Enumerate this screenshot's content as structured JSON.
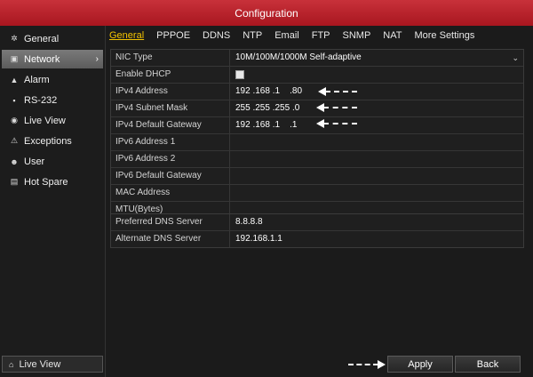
{
  "window": {
    "title": "Configuration"
  },
  "sidebar": {
    "items": [
      {
        "label": "General",
        "icon": "gear-icon"
      },
      {
        "label": "Network",
        "icon": "network-icon"
      },
      {
        "label": "Alarm",
        "icon": "bell-icon"
      },
      {
        "label": "RS-232",
        "icon": "serial-port-icon"
      },
      {
        "label": "Live View",
        "icon": "eye-icon"
      },
      {
        "label": "Exceptions",
        "icon": "warning-icon"
      },
      {
        "label": "User",
        "icon": "users-icon"
      },
      {
        "label": "Hot Spare",
        "icon": "server-icon"
      }
    ],
    "active_index": 1,
    "bottom_button": {
      "label": "Live View",
      "icon": "home-icon"
    }
  },
  "tabs": [
    "General",
    "PPPOE",
    "DDNS",
    "NTP",
    "Email",
    "FTP",
    "SNMP",
    "NAT",
    "More Settings"
  ],
  "active_tab": "General",
  "network_settings": {
    "nic_type": {
      "label": "NIC Type",
      "value": "10M/100M/1000M Self-adaptive"
    },
    "dhcp": {
      "label": "Enable DHCP",
      "checked": false
    },
    "ipv4_address": {
      "label": "IPv4 Address",
      "value": "192 .168 .1    .80"
    },
    "ipv4_subnet_mask": {
      "label": "IPv4 Subnet Mask",
      "value": "255 .255 .255 .0"
    },
    "ipv4_gateway": {
      "label": "IPv4 Default Gateway",
      "value": "192 .168 .1    .1"
    },
    "ipv6_address_1": {
      "label": "IPv6 Address 1",
      "value": ""
    },
    "ipv6_address_2": {
      "label": "IPv6 Address 2",
      "value": ""
    },
    "ipv6_gateway": {
      "label": "IPv6 Default Gateway",
      "value": ""
    },
    "mac_address": {
      "label": "MAC Address",
      "value": ""
    },
    "mtu": {
      "label": "MTU(Bytes)",
      "value": ""
    }
  },
  "dns_settings": {
    "preferred": {
      "label": "Preferred DNS Server",
      "value": "8.8.8.8"
    },
    "alternate": {
      "label": "Alternate DNS Server",
      "value": "192.168.1.1"
    }
  },
  "buttons": {
    "apply": "Apply",
    "back": "Back"
  },
  "colors": {
    "titlebar": "#b5202a",
    "active_tab": "#f2c200",
    "background": "#1b1b1b"
  }
}
